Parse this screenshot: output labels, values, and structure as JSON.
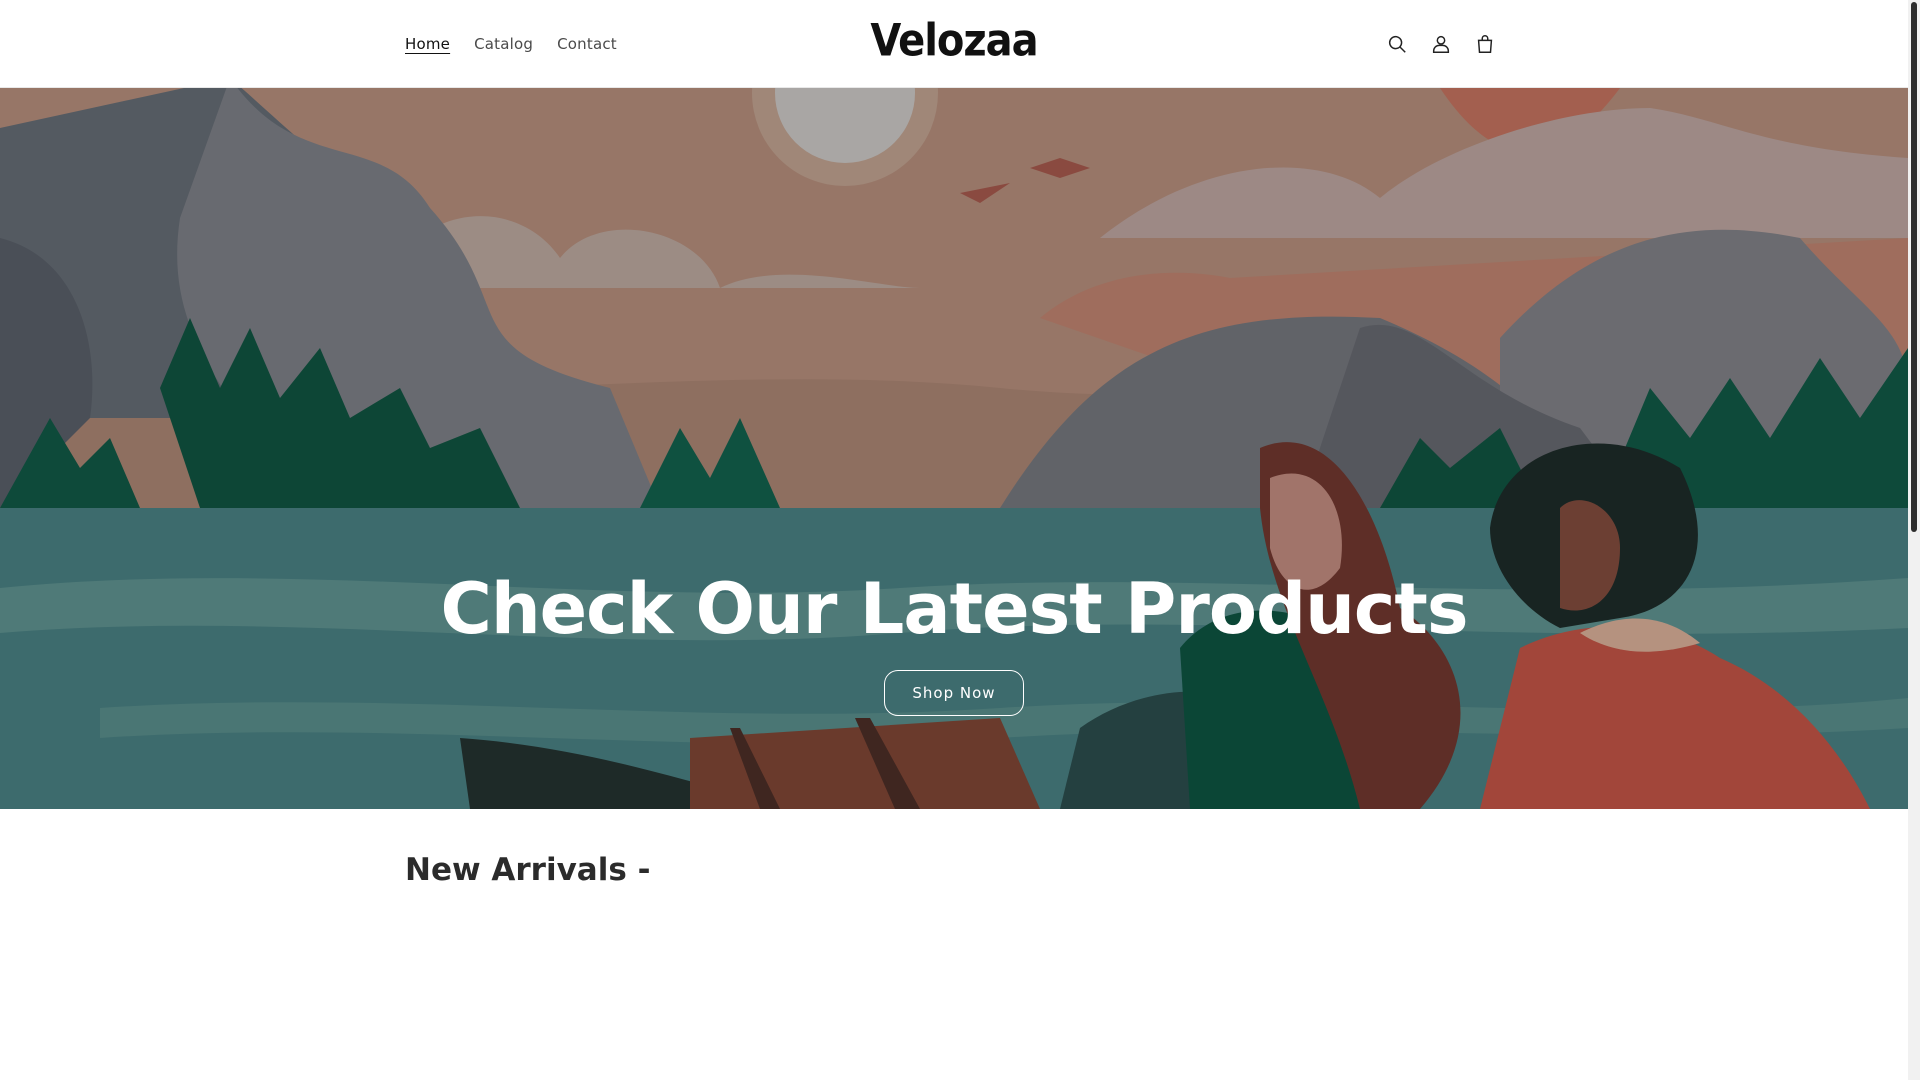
{
  "header": {
    "nav": [
      {
        "label": "Home",
        "active": true
      },
      {
        "label": "Catalog",
        "active": false
      },
      {
        "label": "Contact",
        "active": false
      }
    ],
    "logo": "Velozaa",
    "icons": [
      "search-icon",
      "account-icon",
      "cart-icon"
    ]
  },
  "hero": {
    "title": "Check Our Latest Products",
    "button_label": "Shop Now"
  },
  "new_arrivals": {
    "title": "New Arrivals -"
  },
  "colors": {
    "sky": "#8e6f60",
    "water": "#3b6a6c",
    "forest": "#0e4a3a",
    "text_dark": "#121212"
  }
}
